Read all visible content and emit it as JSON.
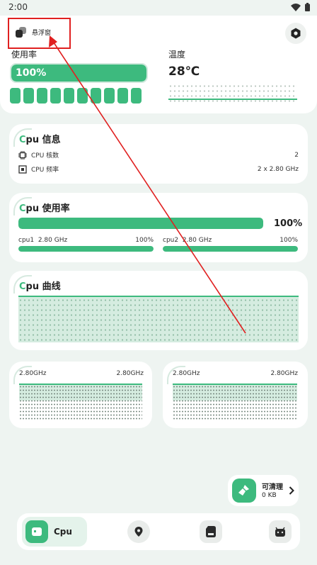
{
  "status": {
    "time": "2:00"
  },
  "header": {
    "floating_window_label": "悬浮窗",
    "usage_label": "使用率",
    "usage_value": "100%",
    "usage_fraction": 1.0,
    "temp_label": "温度",
    "temp_value": "28℃"
  },
  "cpu_info": {
    "title_c": "C",
    "title_rest": "pu 信息",
    "rows": [
      {
        "label": "CPU 核数",
        "value": "2"
      },
      {
        "label": "CPU 频率",
        "value": "2 x 2.80 GHz"
      }
    ]
  },
  "cpu_usage": {
    "title_c": "C",
    "title_rest": "pu 使用率",
    "total_value": "100%",
    "total_fraction": 1.0,
    "cores": [
      {
        "name": "cpu1",
        "freq": "2.80 GHz",
        "value": "100%",
        "fraction": 1.0
      },
      {
        "name": "cpu2",
        "freq": "2.80 GHz",
        "value": "100%",
        "fraction": 1.0
      }
    ]
  },
  "cpu_curve": {
    "title_c": "C",
    "title_rest": "pu 曲线"
  },
  "core_graphs": [
    {
      "left": "2.80GHz",
      "right": "2.80GHz"
    },
    {
      "left": "2.80GHz",
      "right": "2.80GHz"
    }
  ],
  "clean": {
    "title": "可清理",
    "size": "0 KB"
  },
  "nav": {
    "cpu_label": "Cpu"
  },
  "colors": {
    "accent": "#3dba7e",
    "background": "#eef4f1",
    "annotation": "#e02020"
  }
}
